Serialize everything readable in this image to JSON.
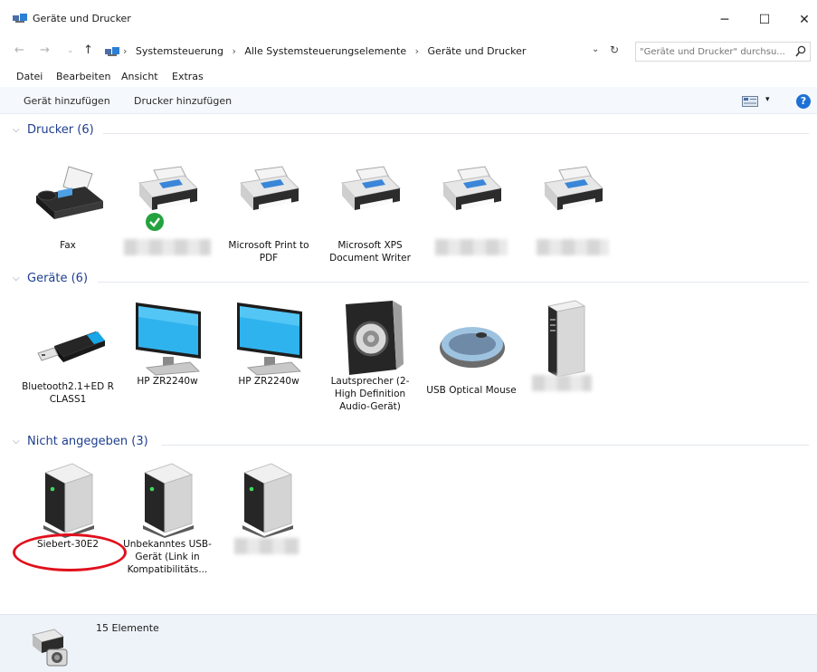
{
  "window": {
    "title": "Geräte und Drucker"
  },
  "address": {
    "crumbs": [
      "Systemsteuerung",
      "Alle Systemsteuerungselemente",
      "Geräte und Drucker"
    ],
    "search_placeholder": "\"Geräte und Drucker\" durchsu..."
  },
  "menu": {
    "items": [
      "Datei",
      "Bearbeiten",
      "Ansicht",
      "Extras"
    ]
  },
  "commands": {
    "add_device": "Gerät hinzufügen",
    "add_printer": "Drucker hinzufügen"
  },
  "groups": {
    "printers": {
      "header": "Drucker (6)",
      "items": [
        {
          "label": "Fax",
          "icon": "fax-icon"
        },
        {
          "label": "",
          "icon": "printer-default-icon",
          "redacted": true
        },
        {
          "label": "Microsoft Print to PDF",
          "icon": "printer-icon"
        },
        {
          "label": "Microsoft XPS Document Writer",
          "icon": "printer-icon"
        },
        {
          "label": "",
          "icon": "printer-icon",
          "redacted": true
        },
        {
          "label": "",
          "icon": "printer-icon",
          "redacted": true
        }
      ]
    },
    "devices": {
      "header": "Geräte (6)",
      "items": [
        {
          "label": "Bluetooth2.1+ED R CLASS1",
          "icon": "bluetooth-dongle-icon"
        },
        {
          "label": "HP ZR2240w",
          "icon": "monitor-icon"
        },
        {
          "label": "HP ZR2240w",
          "icon": "monitor-icon"
        },
        {
          "label": "Lautsprecher (2- High Definition Audio-Gerät)",
          "icon": "speaker-icon"
        },
        {
          "label": "USB Optical Mouse",
          "icon": "mouse-icon"
        },
        {
          "label": "",
          "icon": "computer-tower-icon",
          "redacted": true
        }
      ]
    },
    "unspecified": {
      "header": "Nicht angegeben (3)",
      "items": [
        {
          "label": "Siebert-30E2",
          "icon": "generic-device-icon"
        },
        {
          "label": "Unbekanntes USB-Gerät (Link in Kompatibilitäts...",
          "icon": "generic-device-icon"
        },
        {
          "label": "",
          "icon": "generic-device-icon",
          "redacted": true
        }
      ]
    }
  },
  "status": {
    "count": "15 Elemente"
  },
  "colors": {
    "accent": "#1e3f8f",
    "highlight": "#e0101c",
    "ok_badge": "#23a23f"
  }
}
